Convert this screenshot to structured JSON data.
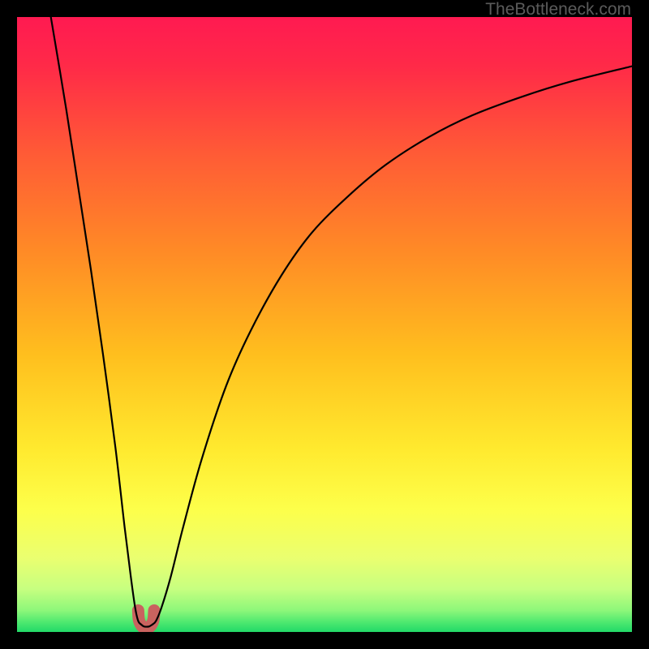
{
  "watermark": {
    "text": "TheBottleneck.com"
  },
  "chart_data": {
    "type": "line",
    "title": "",
    "xlabel": "",
    "ylabel": "",
    "xlim": [
      0,
      100
    ],
    "ylim": [
      0,
      100
    ],
    "curve_left": {
      "name": "left-branch",
      "x": [
        5.5,
        8,
        10,
        12,
        14,
        16,
        17.5,
        18.5,
        19.2,
        19.7,
        20.2
      ],
      "y": [
        100,
        85,
        72,
        59,
        45,
        30,
        17,
        9,
        4,
        1.8,
        1.2
      ]
    },
    "curve_right": {
      "name": "right-branch",
      "x": [
        22.0,
        22.6,
        23.5,
        25,
        27,
        30,
        34,
        38,
        43,
        48,
        54,
        60,
        67,
        74,
        82,
        90,
        100
      ],
      "y": [
        1.2,
        1.8,
        4,
        9,
        17,
        28,
        40,
        49,
        58,
        65,
        71,
        76,
        80.5,
        84,
        87,
        89.5,
        92
      ]
    },
    "flat_bottom": {
      "name": "bottom-knob",
      "x": [
        20.2,
        20.6,
        21.0,
        21.5,
        22.0
      ],
      "y": [
        1.2,
        0.9,
        0.85,
        0.9,
        1.2
      ]
    },
    "gradient_stops": [
      {
        "pos": 0.0,
        "color": "#ff1a51"
      },
      {
        "pos": 0.08,
        "color": "#ff2a48"
      },
      {
        "pos": 0.22,
        "color": "#ff5a36"
      },
      {
        "pos": 0.38,
        "color": "#ff8a26"
      },
      {
        "pos": 0.55,
        "color": "#ffbf1e"
      },
      {
        "pos": 0.7,
        "color": "#ffe92e"
      },
      {
        "pos": 0.8,
        "color": "#fdff4a"
      },
      {
        "pos": 0.88,
        "color": "#eaff70"
      },
      {
        "pos": 0.93,
        "color": "#c7ff80"
      },
      {
        "pos": 0.965,
        "color": "#8df77a"
      },
      {
        "pos": 0.985,
        "color": "#4be86f"
      },
      {
        "pos": 1.0,
        "color": "#22d968"
      }
    ],
    "knob_marker": {
      "center_x": 21.0,
      "y_top": 3.5,
      "half_width": 1.3,
      "color": "#c9635f"
    }
  }
}
